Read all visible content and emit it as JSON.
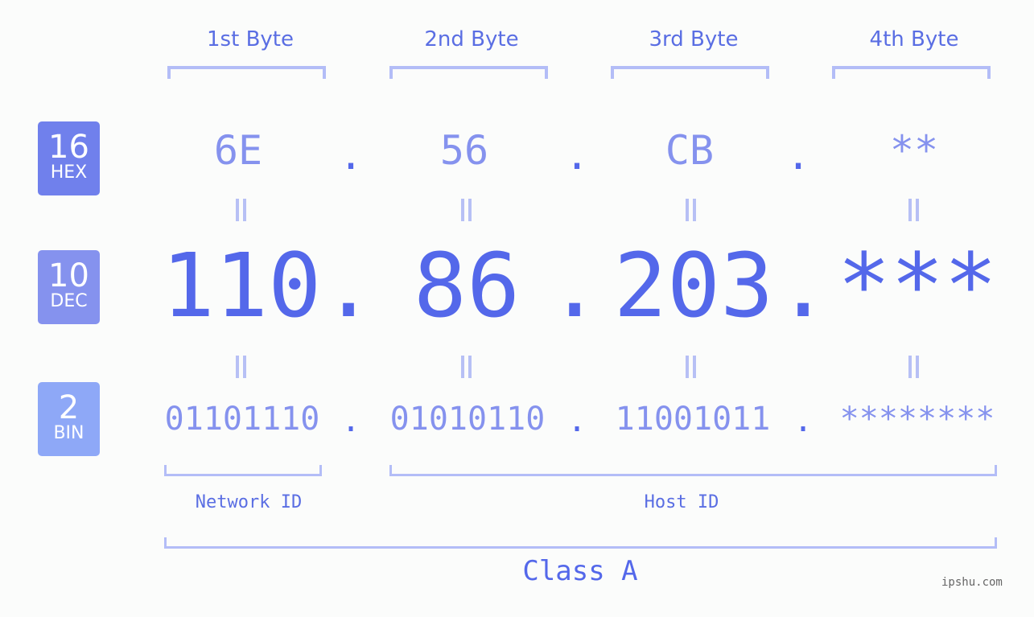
{
  "bases": [
    {
      "number": "16",
      "label": "HEX",
      "color": "#7080ec"
    },
    {
      "number": "10",
      "label": "DEC",
      "color": "#8592ee"
    },
    {
      "number": "2",
      "label": "BIN",
      "color": "#8ea8f7"
    }
  ],
  "byte_titles": [
    "1st Byte",
    "2nd Byte",
    "3rd Byte",
    "4th Byte"
  ],
  "hex": [
    "6E",
    "56",
    "CB",
    "**"
  ],
  "dec": [
    "110",
    "86",
    "203",
    "***"
  ],
  "bin": [
    "01101110",
    "01010110",
    "11001011",
    "********"
  ],
  "separator": ".",
  "network_id_label": "Network ID",
  "host_id_label": "Host ID",
  "class_label": "Class A",
  "watermark": "ipshu.com",
  "colors": {
    "accent": "#5468ea",
    "light_accent": "#8592ee",
    "bracket": "#b3bdf7",
    "background": "#fbfcfb"
  }
}
